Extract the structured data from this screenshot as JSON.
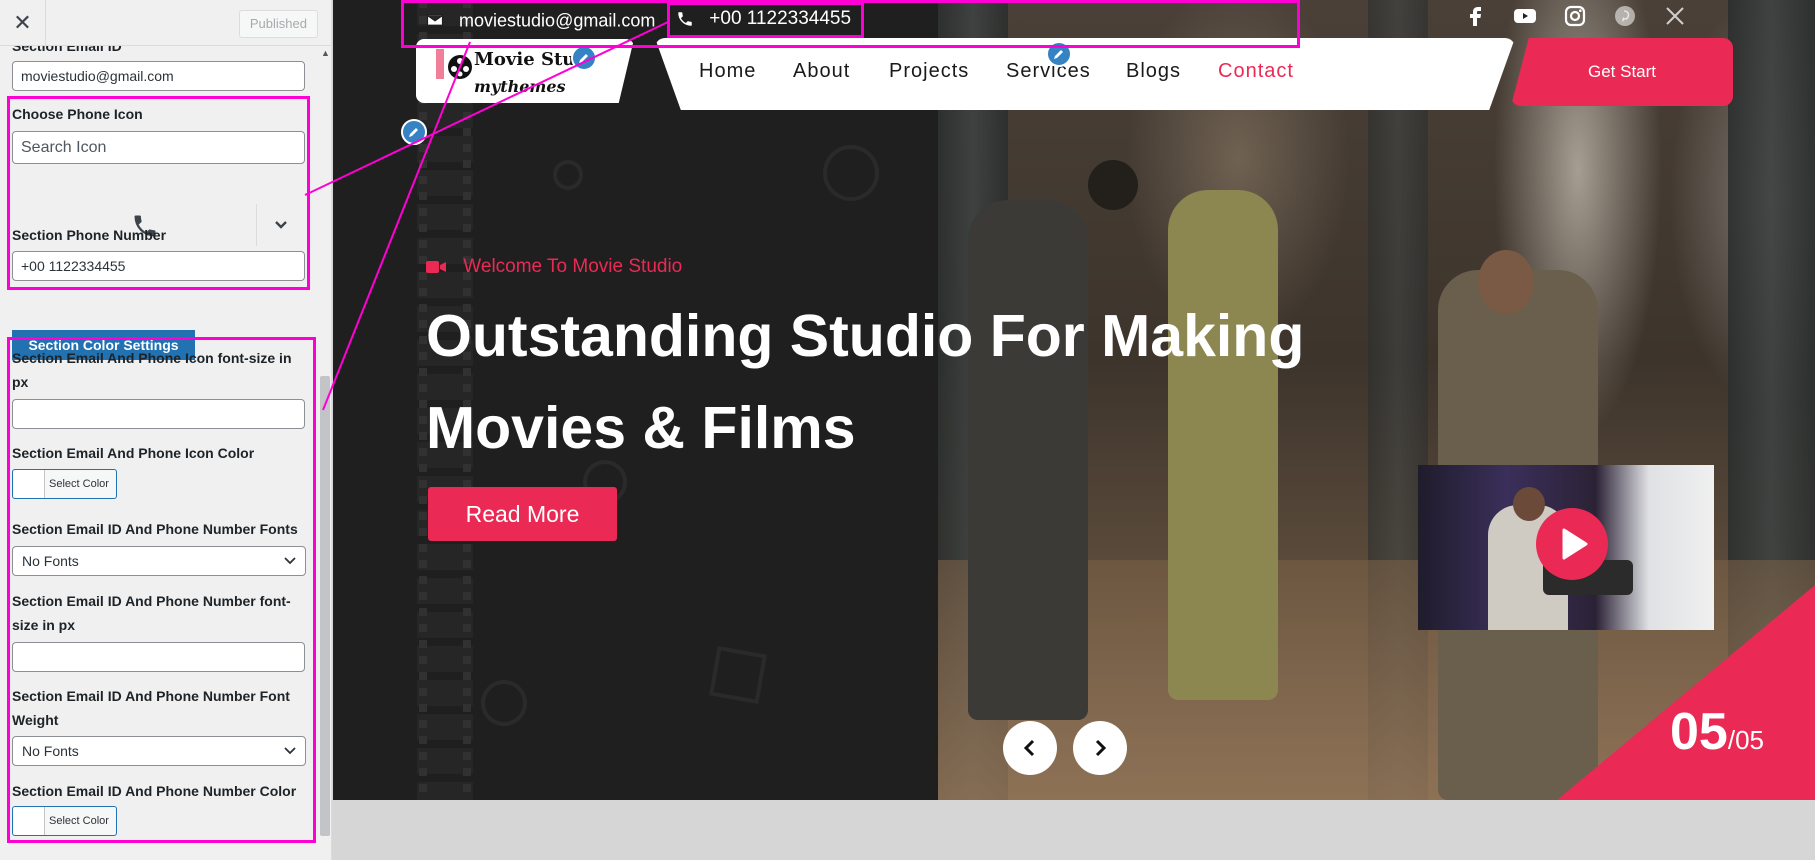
{
  "sidebar": {
    "published_label": "Published",
    "email_section": {
      "label": "Section Email ID",
      "value": "moviestudio@gmail.com"
    },
    "phone_icon": {
      "label": "Choose Phone Icon",
      "search_placeholder": "Search Icon",
      "selected_icon": "phone-icon"
    },
    "phone_number": {
      "label": "Section Phone Number",
      "value": "+00 1122334455"
    },
    "color_settings_button": "Section Color Settings",
    "fields": {
      "icon_font_size_label": "Section Email And Phone Icon font-size in px",
      "icon_color_label": "Section Email And Phone Icon Color",
      "select_color_label": "Select Color",
      "number_fonts_label": "Section Email ID And Phone Number Fonts",
      "number_fonts_value": "No Fonts",
      "number_font_size_label": "Section Email ID And Phone Number font-size in px",
      "number_font_weight_label": "Section Email ID And Phone Number Font Weight",
      "number_font_weight_value": "No Fonts",
      "number_color_label": "Section Email ID And Phone Number Color",
      "select_color_label_2": "Select Color"
    },
    "highlight_color": "#ff00d4"
  },
  "preview": {
    "topbar": {
      "email": "moviestudio@gmail.com",
      "phone": "+00 1122334455",
      "socials": [
        "facebook-icon",
        "youtube-icon",
        "instagram-icon",
        "pinterest-icon",
        "x-icon"
      ]
    },
    "logo": {
      "title": "Movie Stu",
      "subtitle": "mythemes"
    },
    "nav": {
      "items": [
        "Home",
        "About",
        "Projects",
        "Services",
        "Blogs",
        "Contact"
      ],
      "active_index": 5,
      "cta": "Get Start"
    },
    "hero": {
      "welcome": "Welcome To Movie Studio",
      "title": "Outstanding Studio For Making Movies & Films",
      "button": "Read More"
    },
    "slider": {
      "current": "05",
      "total": "/05"
    },
    "accent_color": "#ea2a55"
  }
}
